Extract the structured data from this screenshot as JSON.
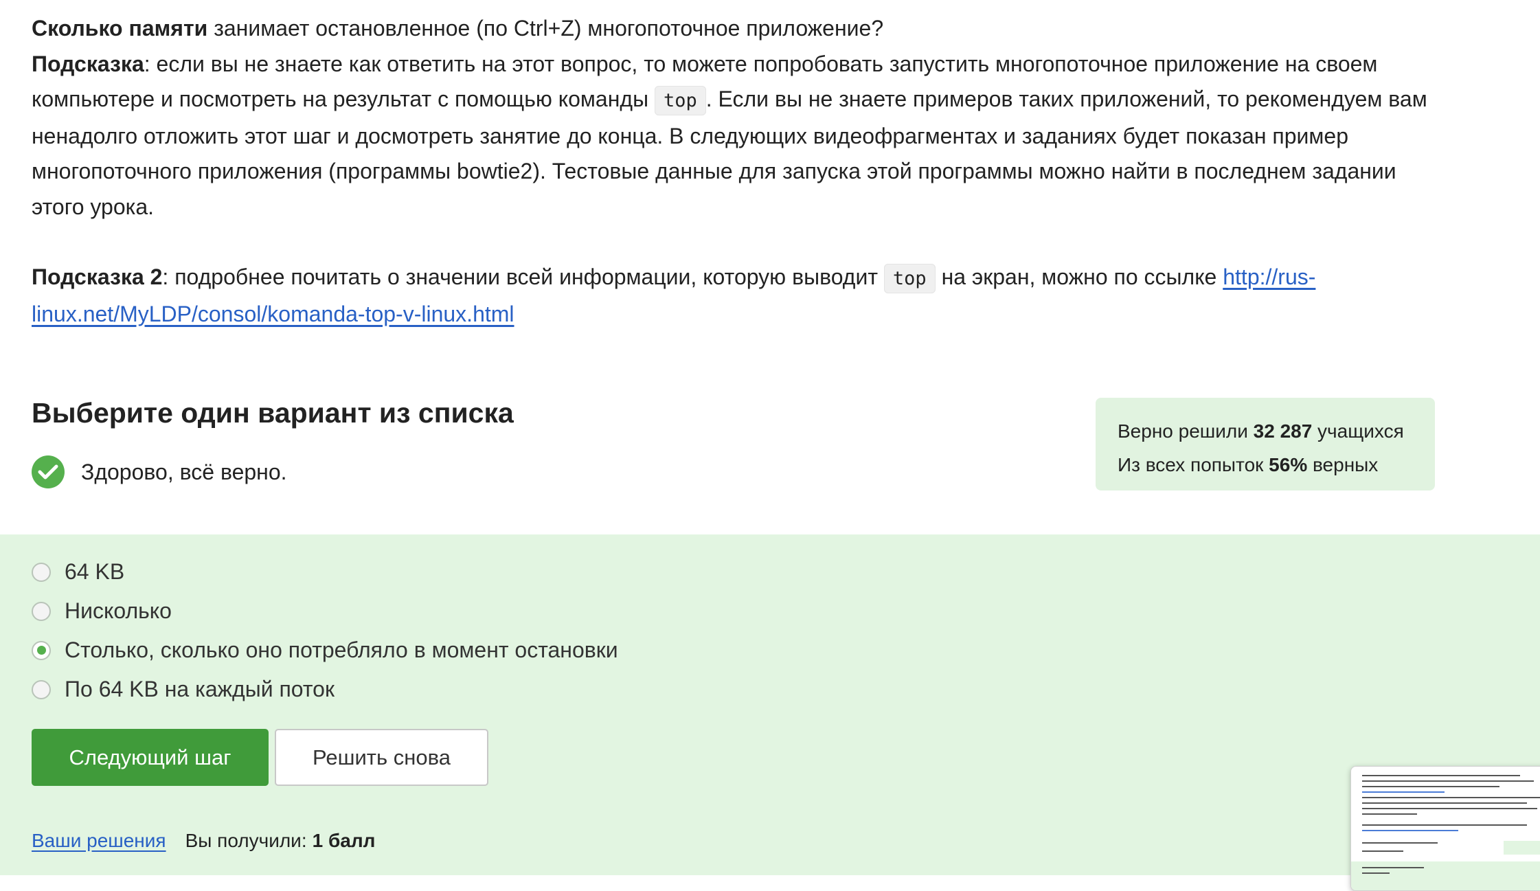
{
  "question": {
    "bold": "Сколько памяти",
    "text": " занимает остановленное (по Ctrl+Z) многопоточное приложение?"
  },
  "hint1": {
    "label": "Подсказка",
    "text_before": ": если вы не знаете как ответить на этот вопрос, то можете попробовать запустить многопоточное приложение на своем компьютере и посмотреть на результат с помощью команды ",
    "code": "top",
    "text_after": ". Если вы не знаете примеров таких приложений, то рекомендуем вам ненадолго отложить этот шаг и досмотреть занятие до конца. В следующих видеофрагментах и заданиях будет показан пример многопоточного приложения (программы bowtie2). Тестовые данные для запуска этой программы можно найти в последнем задании этого урока."
  },
  "hint2": {
    "label": "Подсказка 2",
    "text_before": ": подробнее почитать о значении всей информации, которую выводит ",
    "code": "top",
    "text_after": " на экран, можно по ссылке ",
    "link_text": "http://rus-linux.net/MyLDP/consol/komanda-top-v-linux.html"
  },
  "quiz": {
    "title": "Выберите один вариант из списка",
    "feedback": "Здорово, всё верно.",
    "options": [
      {
        "label": "64 KB",
        "checked": false
      },
      {
        "label": "Нисколько",
        "checked": false
      },
      {
        "label": "Столько, сколько оно потребляло в момент остановки",
        "checked": true
      },
      {
        "label": "По 64 KB на каждый поток",
        "checked": false
      }
    ]
  },
  "stats": {
    "solved_prefix": "Верно решили ",
    "solved_count": "32 287",
    "solved_suffix": " учащихся",
    "attempts_prefix": "Из всех попыток ",
    "attempts_percent": "56%",
    "attempts_suffix": " верных"
  },
  "buttons": {
    "next": "Следующий шаг",
    "retry": "Решить снова"
  },
  "footer": {
    "solutions_link": "Ваши решения",
    "score_label": "Вы получили:",
    "score_value": "1 балл"
  },
  "colors": {
    "accent_green": "#409b3a",
    "success_bg": "#e2f5e1",
    "link_blue": "#2860c5",
    "check_green": "#55b04d"
  }
}
